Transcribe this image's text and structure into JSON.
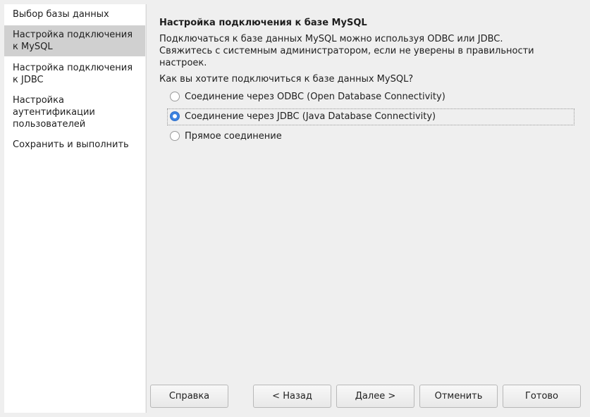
{
  "sidebar": {
    "items": [
      {
        "lines": [
          "Выбор базы данных"
        ]
      },
      {
        "lines": [
          "Настройка подключения",
          "к MySQL"
        ]
      },
      {
        "lines": [
          "Настройка подключения",
          "к JDBC"
        ]
      },
      {
        "lines": [
          "Настройка",
          "аутентификации",
          "пользователей"
        ]
      },
      {
        "lines": [
          "Сохранить и выполнить"
        ]
      }
    ],
    "selected_index": 1
  },
  "main": {
    "title": "Настройка подключения к базе MySQL",
    "description_lines": [
      "Подключаться к базе данных MySQL можно используя ODBC или JDBC.",
      "Свяжитесь с системным администратором, если не уверены в правильности",
      "настроек."
    ],
    "question": "Как вы хотите подключиться к базе данных MySQL?",
    "options": [
      {
        "label": "Соединение через ODBC (Open Database Connectivity)",
        "checked": false
      },
      {
        "label": "Соединение через JDBC (Java Database Connectivity)",
        "checked": true
      },
      {
        "label": "Прямое соединение",
        "checked": false
      }
    ]
  },
  "buttons": {
    "help": "Справка",
    "back": "< Назад",
    "next": "Далее >",
    "cancel": "Отменить",
    "finish": "Готово"
  },
  "colors": {
    "radio_checked": "#3c82e0",
    "sidebar_selected_bg": "#d0d0d0",
    "window_bg": "#efefef"
  }
}
